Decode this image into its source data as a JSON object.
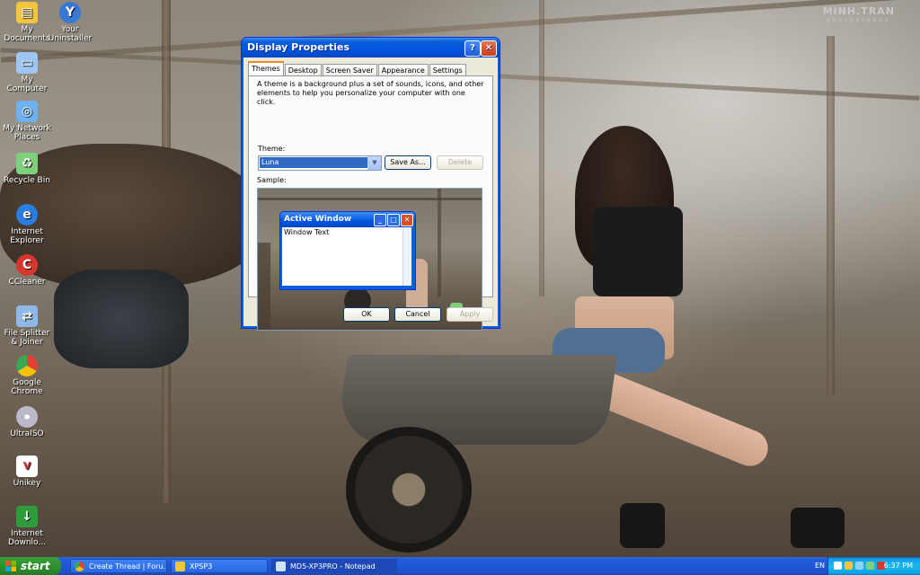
{
  "desktop": {
    "watermark": {
      "title": "MINH.TRAN",
      "subtitle": "photography"
    },
    "icons": [
      {
        "label": "My Documents",
        "icon": "folder-documents-icon",
        "color": "#f2c53d"
      },
      {
        "label": "Your Uninstaller",
        "icon": "uninstaller-icon",
        "color": "#3a78d8"
      },
      {
        "label": "My Computer",
        "icon": "computer-icon",
        "color": "#9fc6f2"
      },
      {
        "label": "My Network Places",
        "icon": "network-icon",
        "color": "#6fb1f0"
      },
      {
        "label": "Recycle Bin",
        "icon": "recycle-bin-icon",
        "color": "#7fd07a"
      },
      {
        "label": "Internet Explorer",
        "icon": "internet-explorer-icon",
        "color": "#2a7de1"
      },
      {
        "label": "CCleaner",
        "icon": "ccleaner-icon",
        "color": "#d9362d"
      },
      {
        "label": "File Splitter & Joiner",
        "icon": "file-splitter-icon",
        "color": "#8fb8e8"
      },
      {
        "label": "Google Chrome",
        "icon": "chrome-icon",
        "color": "#e34133"
      },
      {
        "label": "UltraISO",
        "icon": "disc-icon",
        "color": "#b9b9c9"
      },
      {
        "label": "Unikey",
        "icon": "unikey-icon",
        "color": "#d23a3a"
      },
      {
        "label": "Internet Downlo...",
        "icon": "idm-icon",
        "color": "#2f9c3b"
      }
    ]
  },
  "dialog": {
    "title": "Display Properties",
    "help_glyph": "?",
    "close_glyph": "✕",
    "tabs": [
      "Themes",
      "Desktop",
      "Screen Saver",
      "Appearance",
      "Settings"
    ],
    "active_tab": "Themes",
    "description": "A theme is a background plus a set of sounds, icons, and other elements to help you personalize your computer with one click.",
    "theme_label": "Theme:",
    "theme_value": "Luna",
    "save_as_label": "Save As...",
    "delete_label": "Delete",
    "sample_label": "Sample:",
    "sample_window": {
      "title": "Active Window",
      "text": "Window Text",
      "min_glyph": "_",
      "max_glyph": "□",
      "close_glyph": "✕"
    },
    "ok_label": "OK",
    "cancel_label": "Cancel",
    "apply_label": "Apply"
  },
  "taskbar": {
    "start_label": "start",
    "tasks": [
      {
        "label": "Create Thread | Foru...",
        "icon": "chrome-icon",
        "color": "#e34133",
        "active": false
      },
      {
        "label": "XPSP3",
        "icon": "folder-icon",
        "color": "#f2c53d",
        "active": false
      },
      {
        "label": "MD5-XP3PRO - Notepad",
        "icon": "notepad-icon",
        "color": "#cfe3f7",
        "active": true
      }
    ],
    "language": "EN",
    "clock": "6:37 PM",
    "tray_icons": [
      "network-icon",
      "shield-icon",
      "volume-icon",
      "safely-remove-icon",
      "security-icon"
    ]
  }
}
